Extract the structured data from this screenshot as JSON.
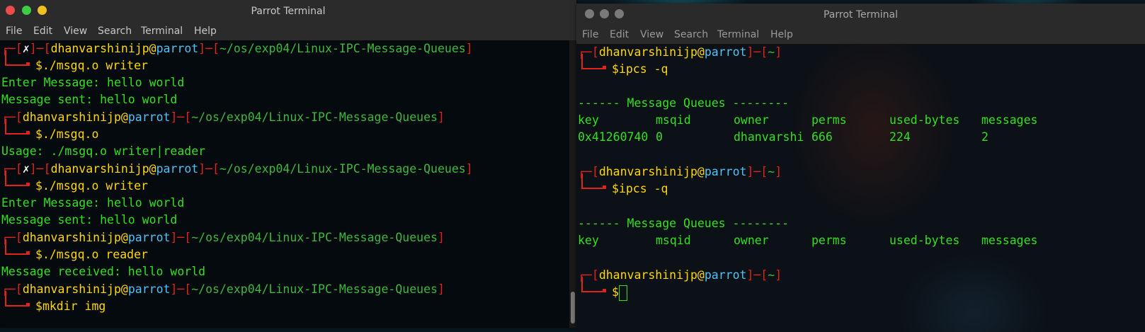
{
  "left_window": {
    "title": "Parrot Terminal",
    "menu": [
      "File",
      "Edit",
      "View",
      "Search",
      "Terminal",
      "Help"
    ],
    "prompt": {
      "user": "dhanvarshinijp",
      "at": "@",
      "host": "parrot",
      "path": "~/os/exp04/Linux-IPC-Message-Queues",
      "fail_mark": "✗",
      "dollar": "$"
    },
    "commands": {
      "c1": "./msgq.o writer",
      "c2": "./msgq.o",
      "c3": "./msgq.o writer",
      "c4": "./msgq.o reader",
      "c5": "mkdir img"
    },
    "output": {
      "o1a": "Enter Message: hello world",
      "o1b": "Message sent: hello world",
      "o2": "Usage: ./msgq.o writer|reader",
      "o3a": "Enter Message: hello world",
      "o3b": "Message sent: hello world",
      "o4": "Message received: hello world"
    }
  },
  "right_window": {
    "title": "Parrot Terminal",
    "menu": [
      "File",
      "Edit",
      "View",
      "Search",
      "Terminal",
      "Help"
    ],
    "prompt": {
      "user": "dhanvarshinijp",
      "at": "@",
      "host": "parrot",
      "path": "~",
      "dollar": "$"
    },
    "commands": {
      "c1": "ipcs -q",
      "c2": "ipcs -q"
    },
    "section_header": "------ Message Queues --------",
    "table_headers": [
      "key",
      "msqid",
      "owner",
      "perms",
      "used-bytes",
      "messages"
    ],
    "row1": [
      "0x41260740",
      "0",
      "dhanvarshi",
      "666",
      "224",
      "2"
    ]
  },
  "colors": {
    "prompt_bracket": "#e2231a",
    "user": "#ffd700",
    "host": "#4fc3f7",
    "path": "#3db83d",
    "output": "#33e01f"
  }
}
